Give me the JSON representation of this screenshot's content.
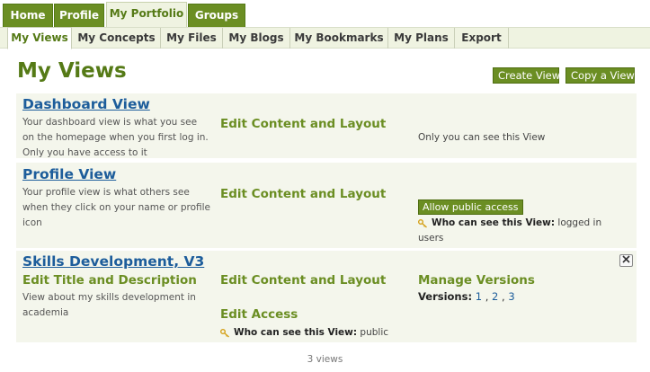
{
  "nav": {
    "top_tabs": [
      "Home",
      "Profile",
      "My Portfolio",
      "Groups"
    ],
    "sub_tabs": [
      "My Views",
      "My Concepts",
      "My Files",
      "My Blogs",
      "My Bookmarks",
      "My Plans",
      "Export"
    ]
  },
  "page": {
    "title": "My Views",
    "create_view": "Create View",
    "copy_view": "Copy a View",
    "count": "3 views"
  },
  "views": [
    {
      "title": "Dashboard View",
      "description": "Your dashboard view is what you see on the homepage when you first log in. Only you have access to it",
      "edit_content": "Edit Content and Layout",
      "access": "Only you can see this View"
    },
    {
      "title": "Profile View",
      "description": "Your profile view is what others see when they click on your name or profile icon",
      "edit_content": "Edit Content and Layout",
      "public_button": "Allow public access",
      "access_label": "Who can see this View:",
      "access_value": "logged in users"
    },
    {
      "title": "Skills Development, V3",
      "edit_title": "Edit Title and Description",
      "description": "View about my skills development in academia",
      "edit_content": "Edit Content and Layout",
      "edit_access": "Edit Access",
      "access_label": "Who can see this View:",
      "access_value": "public",
      "manage_versions": "Manage Versions",
      "versions_label": "Versions:",
      "versions": [
        "1",
        "2",
        "3"
      ],
      "separator": ","
    }
  ],
  "icons": {
    "key": "key-icon",
    "close": "close-icon"
  },
  "colors": {
    "accent": "#6b8e23",
    "title": "#557a16",
    "link": "#1d5d9b",
    "row_bg": "#f4f6ec"
  }
}
